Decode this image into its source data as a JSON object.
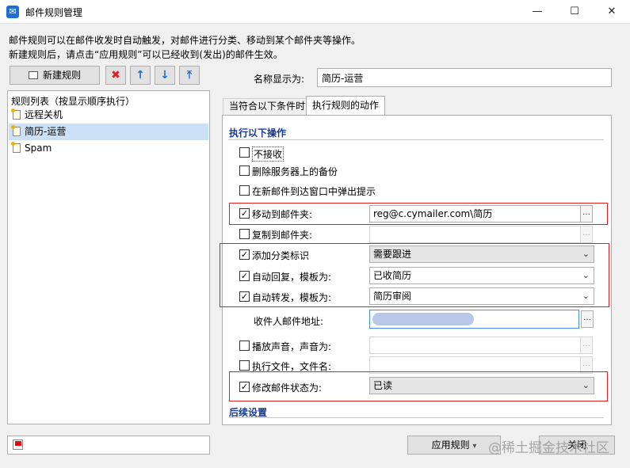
{
  "window": {
    "title": "邮件规则管理",
    "app_icon": "mail-icon",
    "min_glyph": "—",
    "max_glyph": "☐",
    "close_glyph": "✕"
  },
  "description": {
    "line1": "邮件规则可以在邮件收发时自动触发，对邮件进行分类、移动到某个邮件夹等操作。",
    "line2": "新建规则后，请点击“应用规则”可以已经收到(发出)的邮件生效。"
  },
  "toolbar": {
    "new_rule": "新建规则",
    "delete_glyph": "✖",
    "up_glyph": "↑",
    "down_glyph": "↓",
    "top_glyph": "⤒"
  },
  "rule_list": {
    "header": "规则列表（按显示顺序执行）",
    "items": [
      "远程关机",
      "简历-运营",
      "Spam"
    ],
    "selected_index": 1
  },
  "name": {
    "label": "名称显示为:",
    "value": "简历-运营"
  },
  "tabs": {
    "conditions": "当符合以下条件时",
    "actions": "执行规则的动作"
  },
  "actions": {
    "section_title": "执行以下操作",
    "reject": {
      "label": "不接收",
      "checked": false
    },
    "delete_server": {
      "label": "删除服务器上的备份",
      "checked": false
    },
    "popup": {
      "label": "在新邮件到达窗口中弹出提示",
      "checked": false
    },
    "move_to": {
      "label": "移动到邮件夹:",
      "checked": true,
      "value": "reg@c.cymailer.com\\简历"
    },
    "copy_to": {
      "label": "复制到邮件夹:",
      "checked": false,
      "value": ""
    },
    "add_tag": {
      "label": "添加分类标识",
      "checked": true,
      "value": "需要跟进"
    },
    "auto_reply": {
      "label": "自动回复，模板为:",
      "checked": true,
      "value": "已收简历"
    },
    "auto_forward": {
      "label": "自动转发，模板为:",
      "checked": true,
      "value": "简历审阅"
    },
    "recipient": {
      "label": "收件人邮件地址:"
    },
    "play_sound": {
      "label": "播放声音，声音为:",
      "checked": false
    },
    "run_file": {
      "label": "执行文件，文件名:",
      "checked": false
    },
    "change_status": {
      "label": "修改邮件状态为:",
      "checked": true,
      "value": "已读"
    },
    "followup_title": "后续设置",
    "check_glyph": "✓",
    "dots": "…",
    "chevron": "⌄"
  },
  "bottom": {
    "apply": "应用规则",
    "apply_arrow": "▾",
    "close": "关闭",
    "watermark": "@稀土掘金技术社区"
  },
  "colors": {
    "highlight_border": "#e02020",
    "section_title": "#1a3b8f",
    "selected_row": "#cce1f5"
  }
}
